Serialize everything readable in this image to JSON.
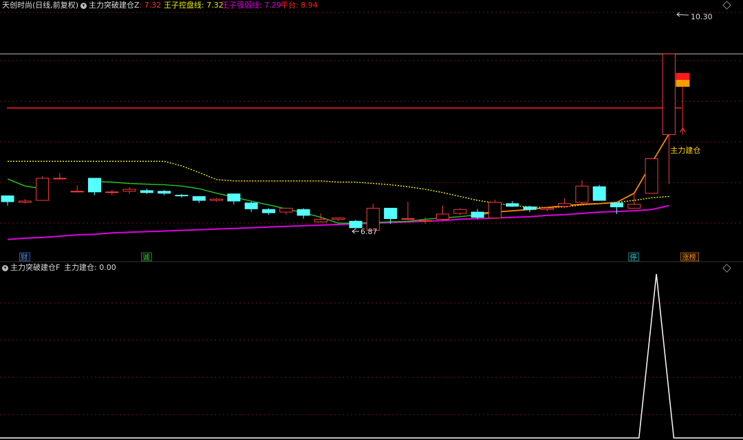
{
  "header": {
    "stock_title": "天创时尚(日线,前复权)",
    "indicator_name": "主力突破建仓Z",
    "indicator_value": ": 7.32",
    "lines": [
      {
        "label": "王子控盘线: 7.32",
        "color": "#e6e600"
      },
      {
        "label": "王子强弱线: 7.29",
        "color": "#e000e0"
      },
      {
        "label": "平台: 8.94",
        "color": "#ff2020"
      }
    ]
  },
  "sub_header": {
    "indicator_name": "主力突破建仓F",
    "value_label": "主力建仓: 0.00"
  },
  "colors": {
    "up": "#ff3b3b",
    "down": "#54ffff",
    "control_line": "#e6e600",
    "strength_line": "#e000e0",
    "platform": "#ff2020",
    "green_ma": "#22cc22",
    "orange_ma": "#ff8800",
    "grid": "#7a1212"
  },
  "chart_data": [
    {
      "type": "candlestick",
      "title": "天创时尚(日线,前复权)",
      "ylim": [
        6.6,
        10.45
      ],
      "max_label": "10.30",
      "min_label": "6.87",
      "reference_levels": {
        "white": 9.77,
        "platform": 8.94
      },
      "candles": [
        {
          "o": 7.59,
          "h": 7.59,
          "l": 7.44,
          "c": 7.5
        },
        {
          "o": 7.49,
          "h": 7.54,
          "l": 7.47,
          "c": 7.51
        },
        {
          "o": 7.52,
          "h": 7.89,
          "l": 7.52,
          "c": 7.86
        },
        {
          "o": 7.86,
          "h": 7.94,
          "l": 7.84,
          "c": 7.86
        },
        {
          "o": 7.66,
          "h": 7.75,
          "l": 7.65,
          "c": 7.66
        },
        {
          "o": 7.86,
          "h": 7.86,
          "l": 7.6,
          "c": 7.65
        },
        {
          "o": 7.64,
          "h": 7.68,
          "l": 7.6,
          "c": 7.65
        },
        {
          "o": 7.66,
          "h": 7.72,
          "l": 7.62,
          "c": 7.69
        },
        {
          "o": 7.67,
          "h": 7.7,
          "l": 7.62,
          "c": 7.64
        },
        {
          "o": 7.66,
          "h": 7.68,
          "l": 7.6,
          "c": 7.63
        },
        {
          "o": 7.6,
          "h": 7.62,
          "l": 7.56,
          "c": 7.59
        },
        {
          "o": 7.58,
          "h": 7.58,
          "l": 7.48,
          "c": 7.52
        },
        {
          "o": 7.52,
          "h": 7.56,
          "l": 7.5,
          "c": 7.54
        },
        {
          "o": 7.62,
          "h": 7.62,
          "l": 7.46,
          "c": 7.51
        },
        {
          "o": 7.48,
          "h": 7.5,
          "l": 7.34,
          "c": 7.39
        },
        {
          "o": 7.38,
          "h": 7.4,
          "l": 7.3,
          "c": 7.33
        },
        {
          "o": 7.34,
          "h": 7.41,
          "l": 7.3,
          "c": 7.4
        },
        {
          "o": 7.38,
          "h": 7.4,
          "l": 7.24,
          "c": 7.29
        },
        {
          "o": 7.19,
          "h": 7.32,
          "l": 7.18,
          "c": 7.23
        },
        {
          "o": 7.23,
          "h": 7.25,
          "l": 7.2,
          "c": 7.25
        },
        {
          "o": 7.2,
          "h": 7.22,
          "l": 7.07,
          "c": 7.1
        },
        {
          "o": 7.06,
          "h": 7.47,
          "l": 7.06,
          "c": 7.4
        },
        {
          "o": 7.4,
          "h": 7.4,
          "l": 7.16,
          "c": 7.24
        },
        {
          "o": 7.24,
          "h": 7.5,
          "l": 7.22,
          "c": 7.24
        },
        {
          "o": 7.2,
          "h": 7.26,
          "l": 7.16,
          "c": 7.21
        },
        {
          "o": 7.23,
          "h": 7.44,
          "l": 7.21,
          "c": 7.31
        },
        {
          "o": 7.32,
          "h": 7.4,
          "l": 7.29,
          "c": 7.38
        },
        {
          "o": 7.34,
          "h": 7.39,
          "l": 7.23,
          "c": 7.26
        },
        {
          "o": 7.25,
          "h": 7.53,
          "l": 7.25,
          "c": 7.49
        },
        {
          "o": 7.47,
          "h": 7.51,
          "l": 7.42,
          "c": 7.43
        },
        {
          "o": 7.42,
          "h": 7.44,
          "l": 7.34,
          "c": 7.38
        },
        {
          "o": 7.38,
          "h": 7.42,
          "l": 7.35,
          "c": 7.4
        },
        {
          "o": 7.43,
          "h": 7.55,
          "l": 7.4,
          "c": 7.47
        },
        {
          "o": 7.49,
          "h": 7.83,
          "l": 7.47,
          "c": 7.74
        },
        {
          "o": 7.73,
          "h": 7.76,
          "l": 7.52,
          "c": 7.52
        },
        {
          "o": 7.48,
          "h": 7.48,
          "l": 7.31,
          "c": 7.42
        },
        {
          "o": 7.4,
          "h": 7.63,
          "l": 7.4,
          "c": 7.46
        },
        {
          "o": 7.63,
          "h": 8.16,
          "l": 7.63,
          "c": 8.16
        },
        {
          "o": 8.53,
          "h": 9.77,
          "l": 7.77,
          "c": 9.77
        }
      ],
      "series": [
        {
          "name": "王子控盘线",
          "color": "#e6e600",
          "values": [
            8.12,
            8.12,
            8.12,
            8.12,
            8.12,
            8.12,
            8.12,
            8.12,
            8.12,
            8.12,
            8.05,
            7.95,
            7.84,
            7.82,
            7.82,
            7.82,
            7.82,
            7.82,
            7.82,
            7.8,
            7.8,
            7.78,
            7.76,
            7.73,
            7.69,
            7.64,
            7.58,
            7.52,
            7.48,
            7.44,
            7.42,
            7.41,
            7.42,
            7.45,
            7.47,
            7.49,
            7.52,
            7.56,
            7.58
          ]
        },
        {
          "name": "王子强弱线",
          "color": "#e000e0",
          "values": [
            6.92,
            6.94,
            6.95,
            6.97,
            6.99,
            7.0,
            7.02,
            7.03,
            7.04,
            7.05,
            7.06,
            7.07,
            7.08,
            7.09,
            7.1,
            7.11,
            7.12,
            7.13,
            7.14,
            7.15,
            7.16,
            7.17,
            7.18,
            7.19,
            7.2,
            7.21,
            7.23,
            7.24,
            7.25,
            7.26,
            7.27,
            7.29,
            7.3,
            7.32,
            7.34,
            7.35,
            7.36,
            7.38,
            7.44
          ]
        },
        {
          "color": "#22cc22",
          "values": [
            7.85,
            7.74,
            7.7,
            null,
            null,
            7.81,
            7.8,
            7.78,
            7.77,
            7.76,
            7.74,
            7.7,
            7.63,
            7.57,
            7.51,
            7.45,
            7.39,
            7.33,
            7.26,
            7.17,
            7.17,
            7.18,
            7.19,
            7.2,
            7.23,
            7.25,
            7.27,
            7.3,
            7.33,
            null,
            null,
            null,
            null,
            null,
            null,
            null,
            null,
            null,
            null
          ]
        },
        {
          "color": "#ff8800",
          "values": [
            null,
            null,
            null,
            null,
            null,
            null,
            null,
            null,
            null,
            null,
            null,
            null,
            null,
            null,
            null,
            null,
            null,
            null,
            null,
            null,
            null,
            null,
            null,
            null,
            null,
            null,
            null,
            7.32,
            7.34,
            7.36,
            7.38,
            7.41,
            7.44,
            7.46,
            7.47,
            7.49,
            7.63,
            8.09,
            8.54
          ]
        }
      ],
      "annotations": [
        {
          "index": 38,
          "text": "主力建仓",
          "color": "#ffd700"
        }
      ],
      "markers": [
        {
          "index": 1,
          "text": "财",
          "color": "#4488ff"
        },
        {
          "index": 8,
          "text": "诚",
          "color": "#22cc22"
        },
        {
          "index": 36,
          "text": "停",
          "color": "#22cccc"
        },
        {
          "index": 39,
          "text": "涨榜",
          "color": "#ff8800"
        }
      ]
    },
    {
      "type": "line",
      "title": "主力突破建仓F",
      "series": [
        {
          "name": "主力建仓",
          "color": "#ffffff",
          "values": [
            0,
            0,
            0,
            0,
            0,
            0,
            0,
            0,
            0,
            0,
            0,
            0,
            0,
            0,
            0,
            0,
            0,
            0,
            0,
            0,
            0,
            0,
            0,
            0,
            0,
            0,
            0,
            0,
            0,
            0,
            0,
            0,
            0,
            0,
            0,
            0,
            0,
            1,
            0
          ]
        }
      ],
      "ylim": [
        0,
        1
      ]
    }
  ]
}
